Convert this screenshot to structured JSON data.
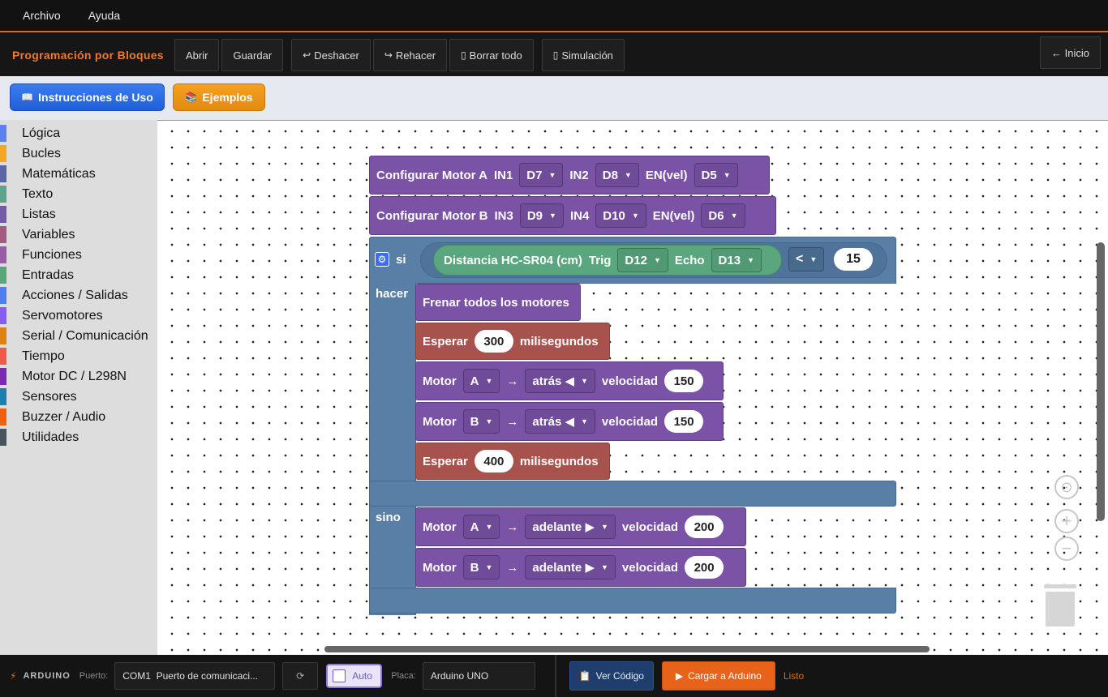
{
  "menu": {
    "items": [
      "Archivo",
      "Ayuda"
    ]
  },
  "toolbar": {
    "title": "Programación por Bloques",
    "abrir": "Abrir",
    "guardar": "Guardar",
    "deshacer": "Deshacer",
    "rehacer": "Rehacer",
    "borrar": "Borrar todo",
    "simulacion": "Simulación",
    "inicio": "← Inicio",
    "undo_glyph": "↩",
    "redo_glyph": "↪",
    "trash_glyph": "▯",
    "sim_glyph": "▯"
  },
  "help": {
    "instrucciones": "Instrucciones de Uso",
    "ejemplos": "Ejemplos",
    "book_glyph": "📖",
    "books_glyph": "📚"
  },
  "categories": [
    {
      "label": "Lógica",
      "color": "#5b80f0"
    },
    {
      "label": "Bucles",
      "color": "#f5a622"
    },
    {
      "label": "Matemáticas",
      "color": "#5b67a5"
    },
    {
      "label": "Texto",
      "color": "#5ba58c"
    },
    {
      "label": "Listas",
      "color": "#745ba5"
    },
    {
      "label": "Variables",
      "color": "#a55b80"
    },
    {
      "label": "Funciones",
      "color": "#995ba5"
    },
    {
      "label": "Entradas",
      "color": "#5ba57a"
    },
    {
      "label": "Acciones / Salidas",
      "color": "#4c80f0"
    },
    {
      "label": "Servomotores",
      "color": "#8a5bf0"
    },
    {
      "label": "Serial / Comunicación",
      "color": "#e08010"
    },
    {
      "label": "Tiempo",
      "color": "#f05a4a"
    },
    {
      "label": "Motor DC / L298N",
      "color": "#7a2ab0"
    },
    {
      "label": "Sensores",
      "color": "#1a80b0"
    },
    {
      "label": "Buzzer / Audio",
      "color": "#f06010"
    },
    {
      "label": "Utilidades",
      "color": "#455560"
    }
  ],
  "blocks": {
    "motor_a_cfg": {
      "title": "Configurar Motor A",
      "in1": "IN1",
      "pin1": "D7",
      "in2": "IN2",
      "pin2": "D8",
      "en": "EN(vel)",
      "pin3": "D5"
    },
    "motor_b_cfg": {
      "title": "Configurar Motor B",
      "in3": "IN3",
      "pin1": "D9",
      "in4": "IN4",
      "pin2": "D10",
      "en": "EN(vel)",
      "pin3": "D6"
    },
    "if": {
      "si": "si",
      "hacer": "hacer",
      "sino": "sino"
    },
    "sensor": {
      "title": "Distancia HC-SR04 (cm)",
      "trig": "Trig",
      "trig_pin": "D12",
      "echo": "Echo",
      "echo_pin": "D13",
      "op": "<",
      "value": "15"
    },
    "stop": {
      "label": "Frenar todos los motores"
    },
    "wait1": {
      "label": "Esperar",
      "value": "300",
      "unit": "milisegundos"
    },
    "motor_a_back": {
      "label": "Motor",
      "motor": "A",
      "arrow": "→",
      "dir": "atrás ◀",
      "vel": "velocidad",
      "value": "150"
    },
    "motor_b_back": {
      "label": "Motor",
      "motor": "B",
      "arrow": "→",
      "dir": "atrás ◀",
      "vel": "velocidad",
      "value": "150"
    },
    "wait2": {
      "label": "Esperar",
      "value": "400",
      "unit": "milisegundos"
    },
    "motor_a_fwd": {
      "label": "Motor",
      "motor": "A",
      "arrow": "→",
      "dir": "adelante ▶",
      "vel": "velocidad",
      "value": "200"
    },
    "motor_b_fwd": {
      "label": "Motor",
      "motor": "B",
      "arrow": "→",
      "dir": "adelante ▶",
      "vel": "velocidad",
      "value": "200"
    }
  },
  "workspace_controls": {
    "center": "⊙",
    "zoom_in": "+",
    "zoom_out": "−"
  },
  "status": {
    "brand_glyph": "⚡",
    "brand": "ARDUINO",
    "port_label": "Puerto:",
    "port_value": "COM1  Puerto de comunicaci...",
    "refresh": "⟳",
    "auto": "Auto",
    "board_label": "Placa:",
    "board_value": "Arduino UNO",
    "ver_codigo": "Ver Código",
    "cargar": "Cargar a Arduino",
    "state": "Listo",
    "code_glyph": "📋",
    "play_glyph": "▶"
  }
}
